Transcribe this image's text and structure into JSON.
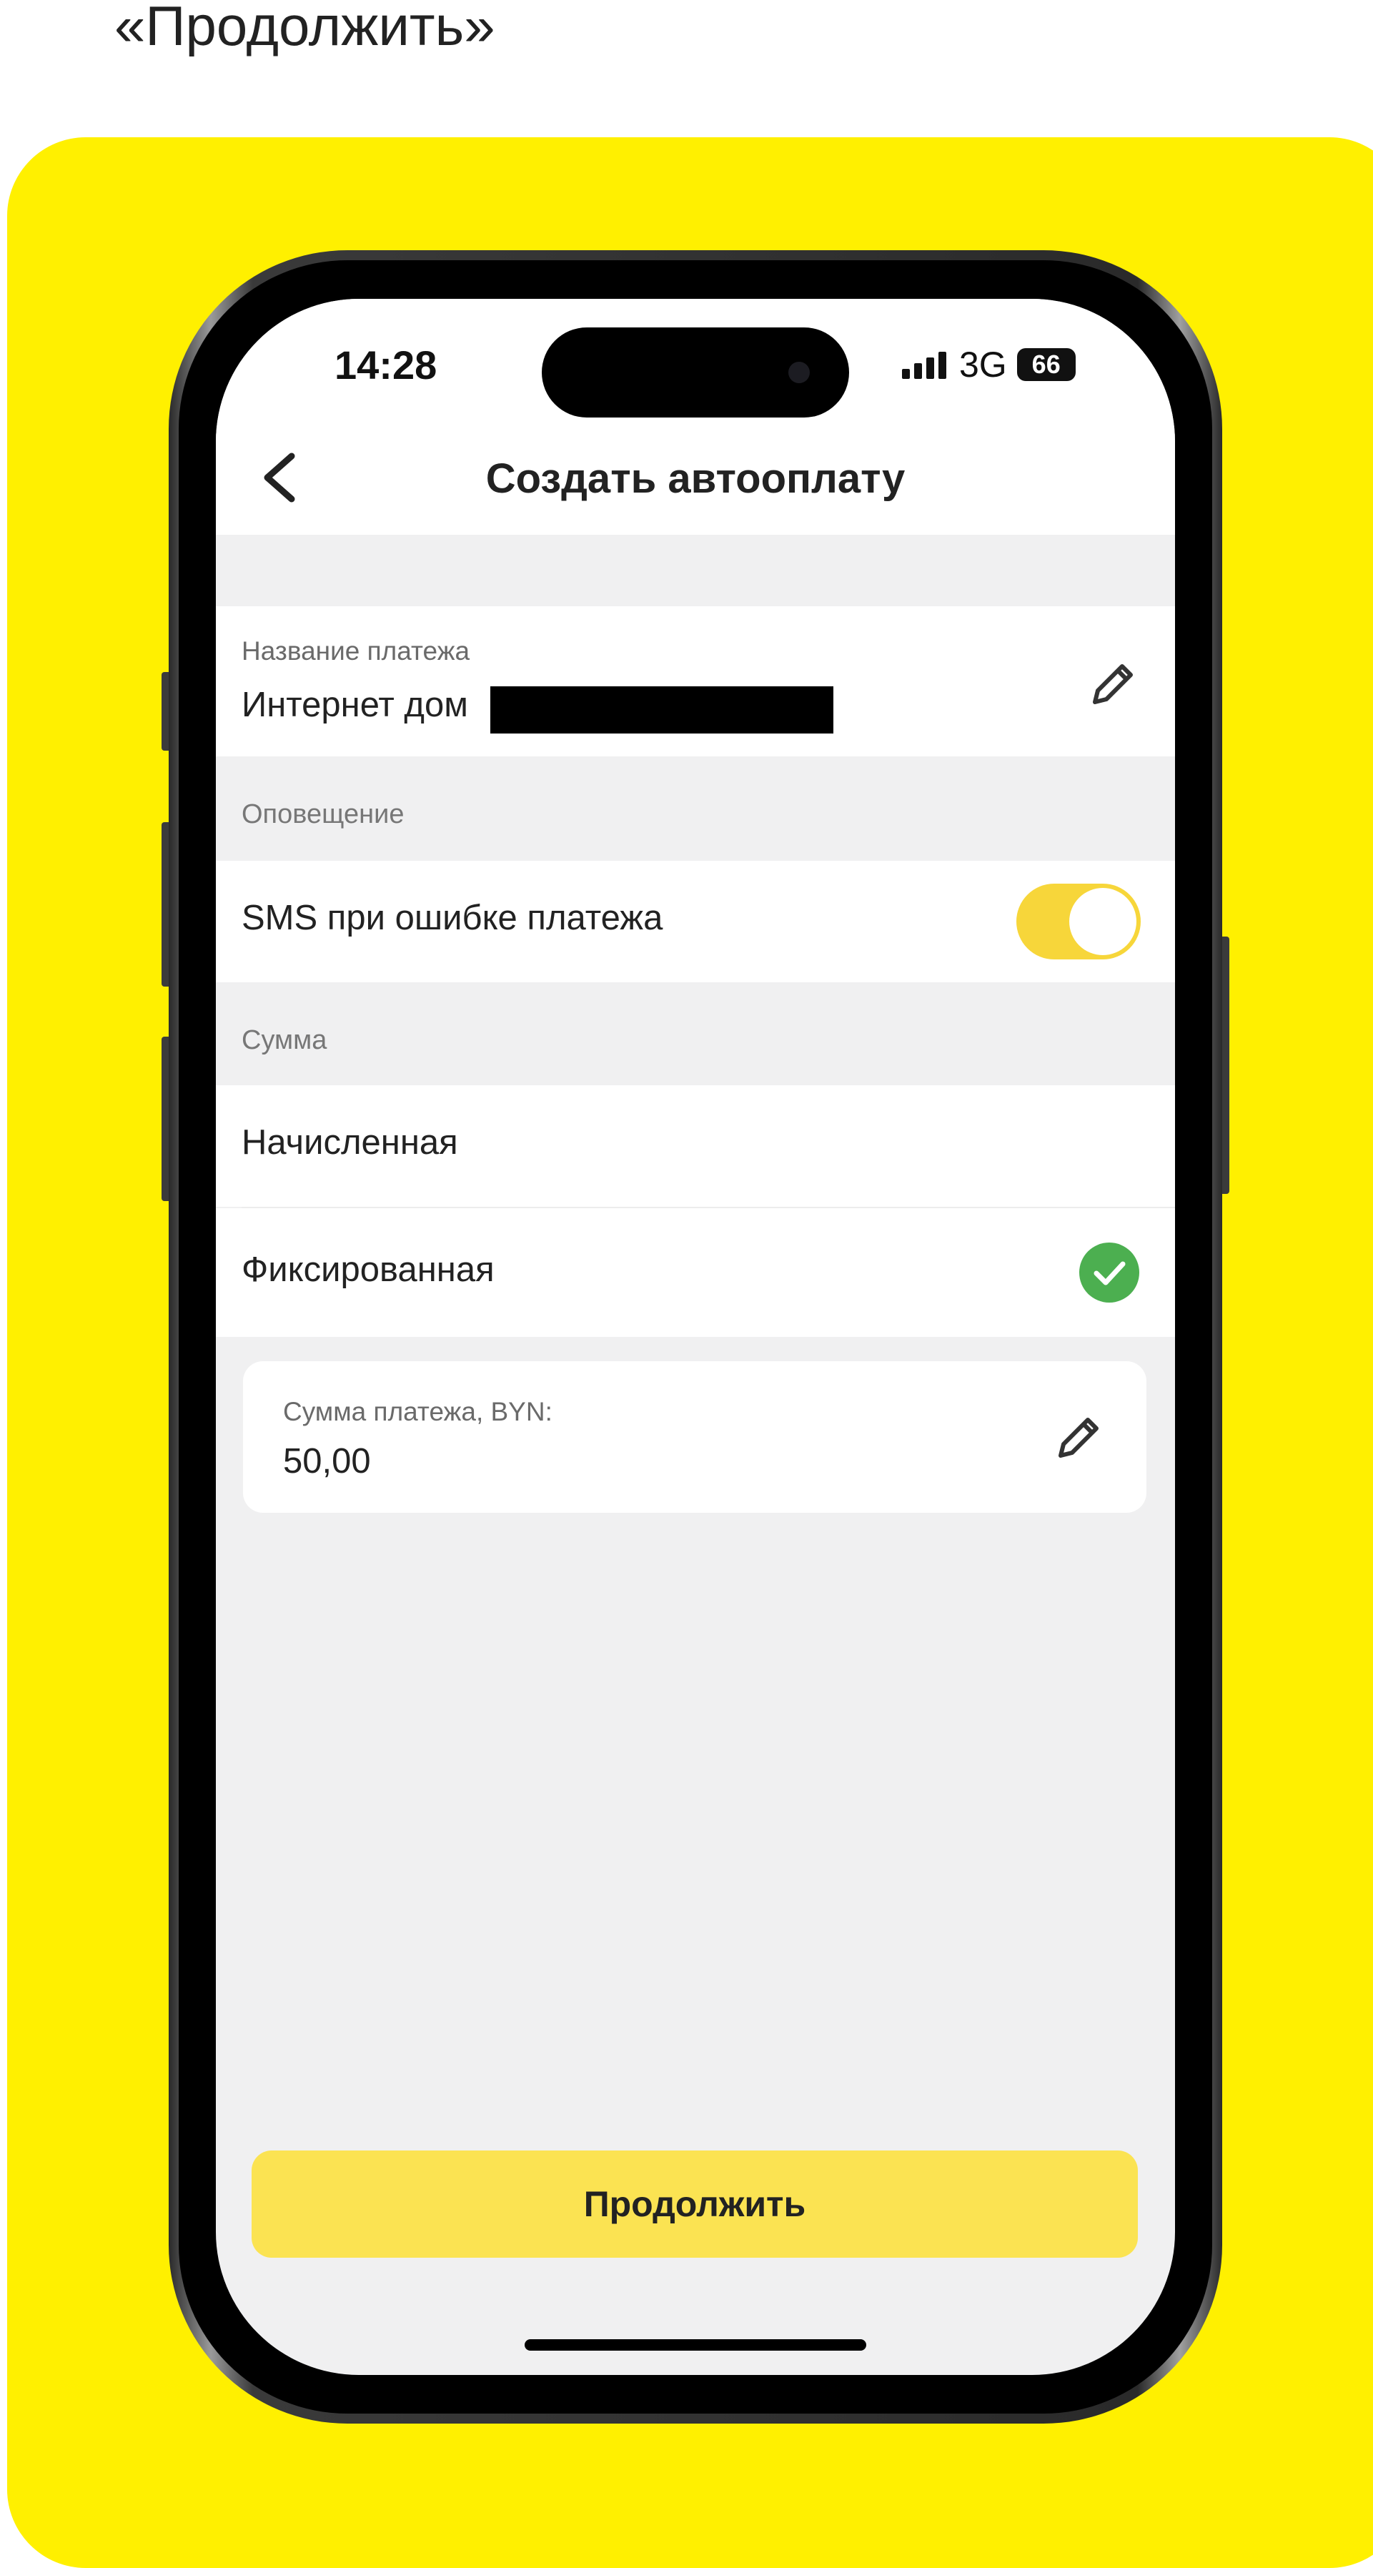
{
  "caption": "«Продолжить»",
  "status_bar": {
    "time": "14:28",
    "network": "3G",
    "battery": "66"
  },
  "header": {
    "title": "Создать автооплату"
  },
  "payment_name": {
    "label": "Название платежа",
    "value": "Интернет дом"
  },
  "notification": {
    "section_label": "Оповещение",
    "sms_label": "SMS при ошибке платежа",
    "sms_enabled": true
  },
  "amount": {
    "section_label": "Сумма",
    "options": [
      "Начисленная",
      "Фиксированная"
    ],
    "selected": "Фиксированная",
    "payment_label": "Сумма платежа, BYN:",
    "payment_value": "50,00"
  },
  "footer": {
    "continue_label": "Продолжить"
  },
  "colors": {
    "brand_yellow": "#fff000",
    "button_yellow": "#fbe352",
    "toggle_on": "#f7d63a",
    "check_green": "#4caf50"
  }
}
